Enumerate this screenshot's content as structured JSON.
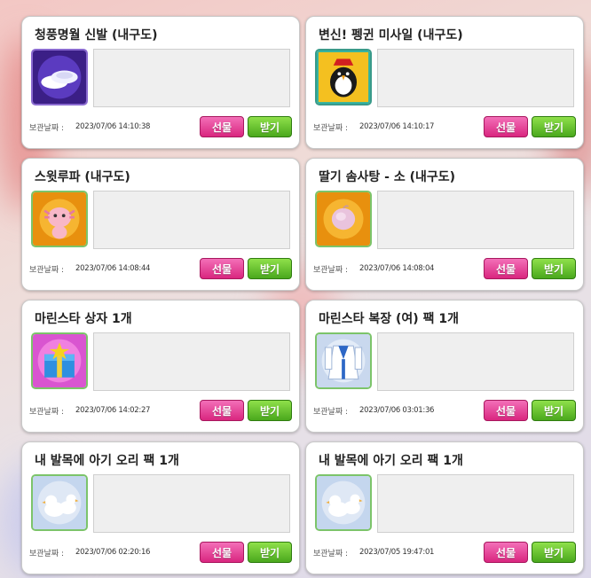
{
  "date_label": "보관날짜 :",
  "buttons": {
    "gift": "선물",
    "receive": "받기"
  },
  "items": [
    {
      "title": "청풍명월 신발 (내구도)",
      "date": "2023/07/06 14:10:38",
      "icon": "white-shoes-icon"
    },
    {
      "title": "변신! 펭귄 미사일 (내구도)",
      "date": "2023/07/06 14:10:17",
      "icon": "penguin-missile-icon"
    },
    {
      "title": "스윗루파 (내구도)",
      "date": "2023/07/06 14:08:44",
      "icon": "axolotl-pet-icon"
    },
    {
      "title": "딸기 솜사탕 - 소 (내구도)",
      "date": "2023/07/06 14:08:04",
      "icon": "cotton-candy-icon"
    },
    {
      "title": "마린스타 상자 1개",
      "date": "2023/07/06 14:02:27",
      "icon": "gift-box-icon"
    },
    {
      "title": "마린스타 복장 (여) 팩 1개",
      "date": "2023/07/06 03:01:36",
      "icon": "marine-outfit-icon"
    },
    {
      "title": "내 발목에 아기 오리 팩 1개",
      "date": "2023/07/06 02:20:16",
      "icon": "baby-duck-icon"
    },
    {
      "title": "내 발목에 아기 오리 팩 1개",
      "date": "2023/07/05 19:47:01",
      "icon": "baby-duck-icon"
    }
  ]
}
